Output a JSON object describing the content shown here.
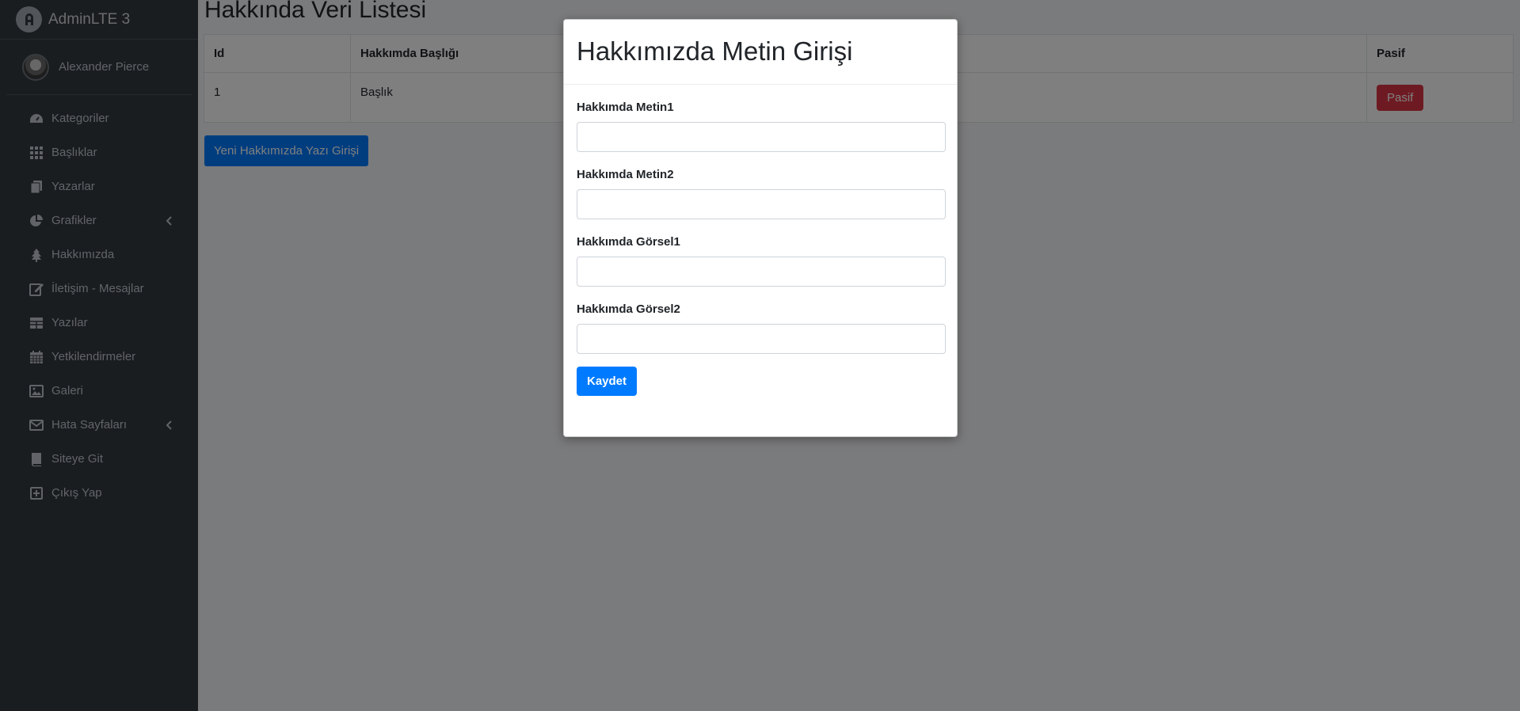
{
  "brand": {
    "name": "AdminLTE 3",
    "logo_icon": "adminlte-logo-icon"
  },
  "user": {
    "name": "Alexander Pierce"
  },
  "sidebar": {
    "items": [
      {
        "label": "Kategoriler",
        "icon": "tachometer-icon"
      },
      {
        "label": "Başlıklar",
        "icon": "grid-icon"
      },
      {
        "label": "Yazarlar",
        "icon": "copy-icon"
      },
      {
        "label": "Grafikler",
        "icon": "pie-chart-icon",
        "has_submenu": true
      },
      {
        "label": "Hakkımızda",
        "icon": "tree-icon"
      },
      {
        "label": "İletişim - Mesajlar",
        "icon": "edit-icon"
      },
      {
        "label": "Yazılar",
        "icon": "table-icon"
      },
      {
        "label": "Yetkilendirmeler",
        "icon": "calendar-icon"
      },
      {
        "label": "Galeri",
        "icon": "image-icon"
      },
      {
        "label": "Hata Sayfaları",
        "icon": "envelope-icon",
        "has_submenu": true
      },
      {
        "label": "Siteye Git",
        "icon": "book-icon"
      },
      {
        "label": "Çıkış Yap",
        "icon": "plus-square-icon"
      }
    ]
  },
  "main": {
    "title": "Hakkında Veri Listesi",
    "table": {
      "headers": [
        "Id",
        "Hakkımda Başlığı",
        "",
        "Pasif"
      ],
      "rows": [
        {
          "id": "1",
          "title": "Başlık",
          "action_label": "Pasif"
        }
      ]
    },
    "new_button_label": "Yeni Hakkımızda Yazı Girişi"
  },
  "modal": {
    "title": "Hakkımızda Metin Girişi",
    "fields": [
      {
        "label": "Hakkımda Metin1",
        "value": ""
      },
      {
        "label": "Hakkımda Metin2",
        "value": ""
      },
      {
        "label": "Hakkımda Görsel1",
        "value": ""
      },
      {
        "label": "Hakkımda Görsel2",
        "value": ""
      }
    ],
    "save_label": "Kaydet"
  },
  "colors": {
    "sidebar_bg": "#343a40",
    "primary": "#007bff",
    "danger": "#dc3545",
    "backdrop": "rgba(0,0,0,0.5)"
  }
}
